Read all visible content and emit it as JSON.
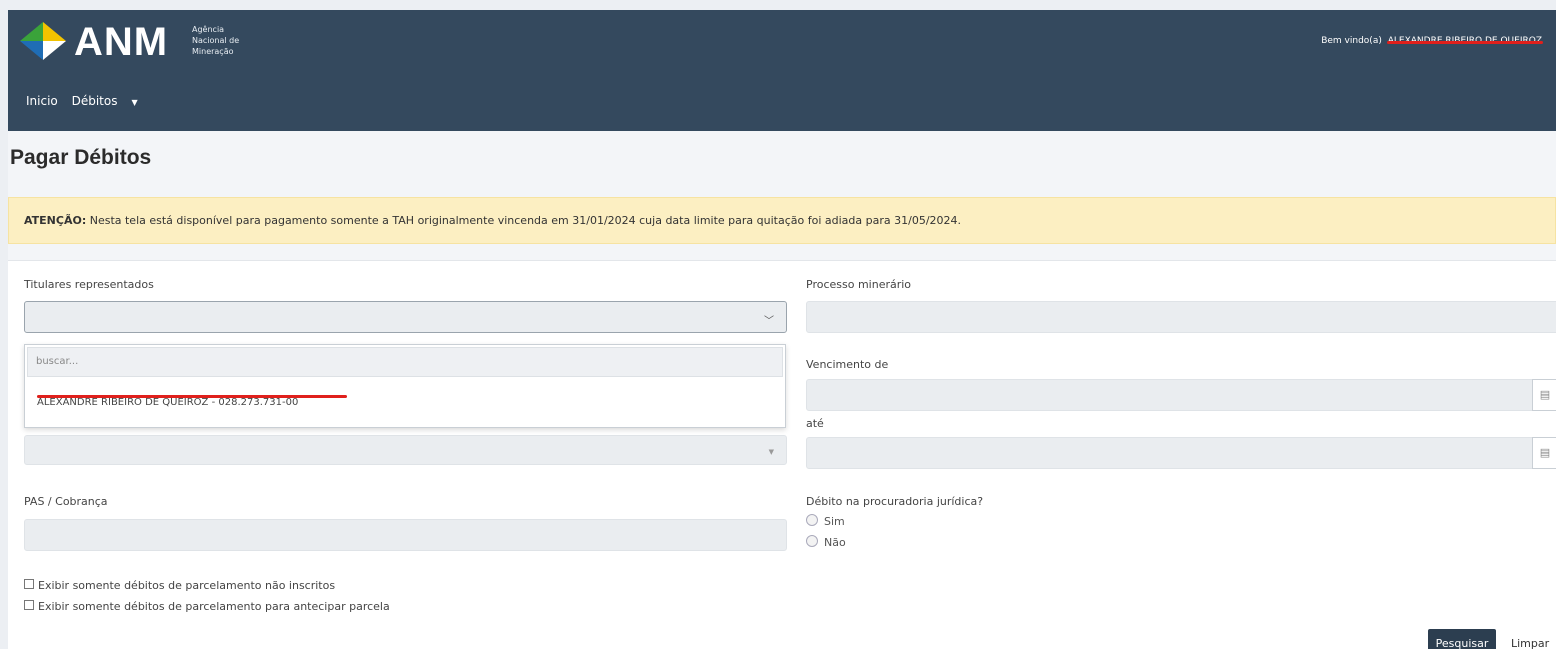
{
  "header": {
    "logo_text": "ANM",
    "logo_sub": [
      "Agência",
      "Nacional de",
      "Mineração"
    ],
    "welcome_prefix": "Bem vindo(a)",
    "welcome_user": "ALEXANDRE RIBEIRO DE QUEIROZ",
    "nav": [
      "Inicio",
      "Débitos"
    ]
  },
  "page": {
    "title": "Pagar Débitos",
    "alert_bold": "ATENÇÃO:",
    "alert_text": " Nesta tela está disponível para pagamento somente a TAH originalmente vincenda em 31/01/2024 cuja data limite para quitação foi adiada para 31/05/2024."
  },
  "form": {
    "titulares_label": "Titulares representados",
    "search_placeholder": "buscar...",
    "titular_option": "ALEXANDRE RIBEIRO DE QUEIROZ - 028.273.731-00",
    "processo_label": "Processo minerário",
    "vencimento_label": "Vencimento de",
    "ate_label": "até",
    "pas_label": "PAS / Cobrança",
    "procuradoria_label": "Débito na procuradoria jurídica?",
    "radio_sim": "Sim",
    "radio_nao": "Não",
    "check1": "Exibir somente débitos de parcelamento não inscritos",
    "check2": "Exibir somente débitos de parcelamento para antecipar parcela",
    "search_button": "Pesquisar",
    "clear_link": "Limpar"
  },
  "colors": {
    "header": "#34495e",
    "alert_bg": "#fcefc2",
    "button": "#2c3e50",
    "redaction": "#e0201c"
  }
}
